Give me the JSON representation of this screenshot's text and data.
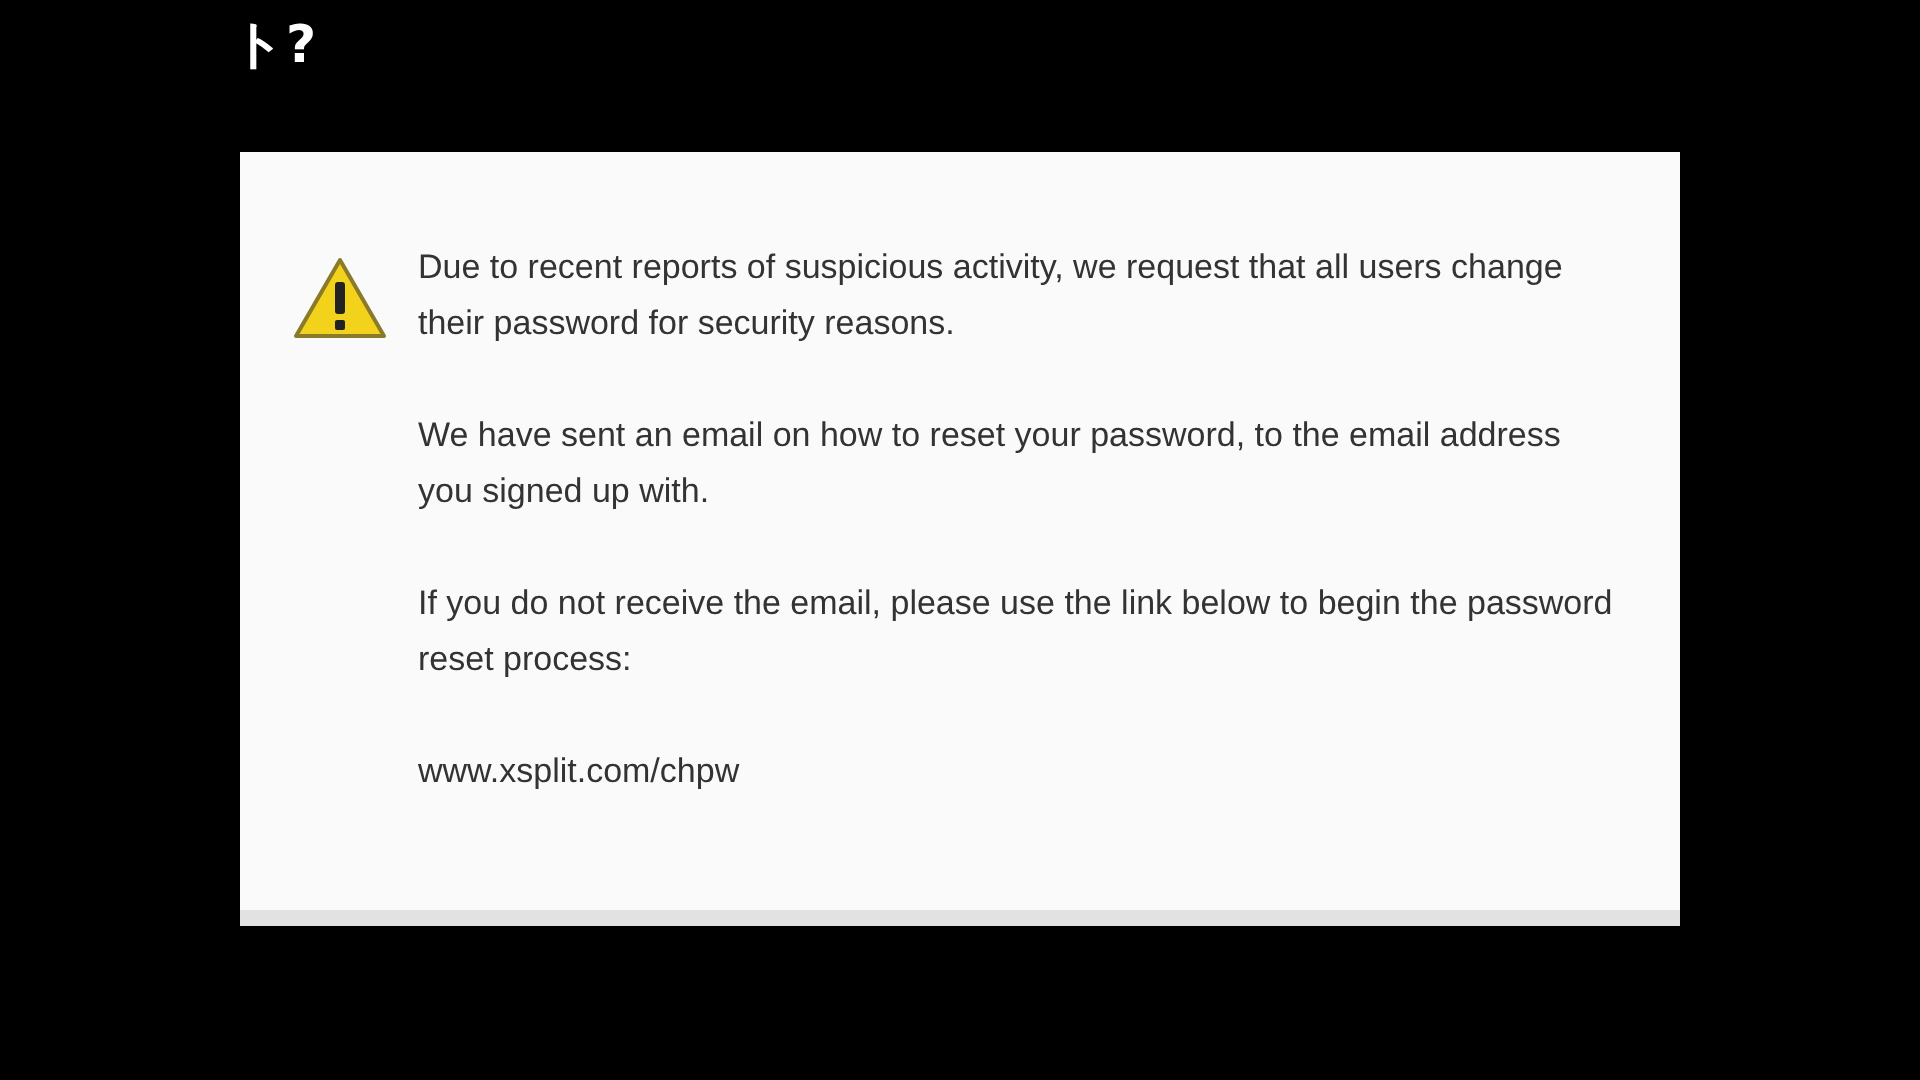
{
  "heading_fragment": "ト?",
  "dialog": {
    "paragraphs": [
      "Due to recent reports of suspicious activity, we request that all users change their password for security reasons.",
      "We have sent an email on how to reset your password, to the email address you signed up with.",
      "If you do not receive the email, please use the link below to begin the password reset process:"
    ],
    "link": "www.xsplit.com/chpw"
  }
}
